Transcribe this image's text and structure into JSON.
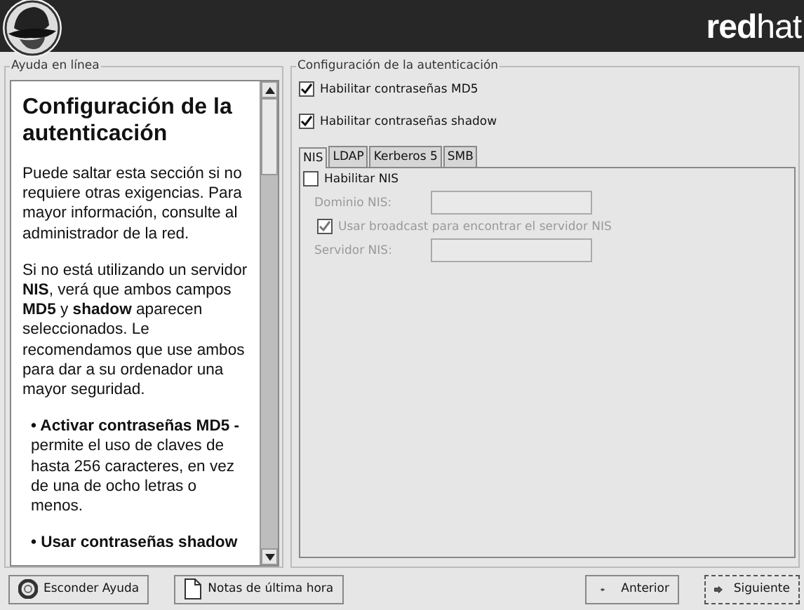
{
  "header": {
    "brand_bold": "red",
    "brand_light": "hat"
  },
  "help": {
    "label": "Ayuda en línea",
    "title": "Configuración de la autenticación",
    "paragraphs": [
      {
        "kind": "text",
        "text": "Puede saltar esta sección si no requiere otras exigencias. Para mayor información, consulte al administrador de la red."
      },
      {
        "kind": "text",
        "text": "Si no está utilizando un servidor **NIS**, verá que ambos campos **MD5** y **shadow** aparecen seleccionados. Le recomendamos que use ambos para dar a su ordenador una mayor seguridad."
      },
      {
        "kind": "bullet",
        "text": "**• Activar contraseñas MD5 -** permite el uso de claves de hasta 256 caracteres, en vez de una de ocho letras o menos."
      },
      {
        "kind": "bullet",
        "text": "**• Usar contraseñas shadow**"
      }
    ]
  },
  "auth": {
    "label": "Configuración de la autenticación",
    "options": [
      {
        "label": "Habilitar contraseñas MD5",
        "checked": true
      },
      {
        "label": "Habilitar contraseñas shadow",
        "checked": true
      }
    ],
    "tabs": [
      {
        "label": "NIS",
        "selected": true
      },
      {
        "label": "LDAP",
        "selected": false
      },
      {
        "label": "Kerberos 5",
        "selected": false
      },
      {
        "label": "SMB",
        "selected": false
      }
    ],
    "nis": [
      {
        "kind": "checkbox",
        "label": "Habilitar NIS",
        "checked": false,
        "disabled": false
      },
      {
        "kind": "field",
        "label": "Dominio NIS:",
        "disabled": true
      },
      {
        "kind": "checkbox",
        "label": "Usar broadcast para encontrar el servidor NIS",
        "checked": true,
        "disabled": true
      },
      {
        "kind": "field",
        "label": "Servidor NIS:",
        "disabled": true
      }
    ]
  },
  "buttons": [
    {
      "label": "Esconder Ayuda",
      "kind": "help"
    },
    {
      "label": "Notas de última hora",
      "kind": "notes"
    },
    {
      "label": "Anterior",
      "kind": "back"
    },
    {
      "label": "Siguiente",
      "kind": "next"
    }
  ]
}
